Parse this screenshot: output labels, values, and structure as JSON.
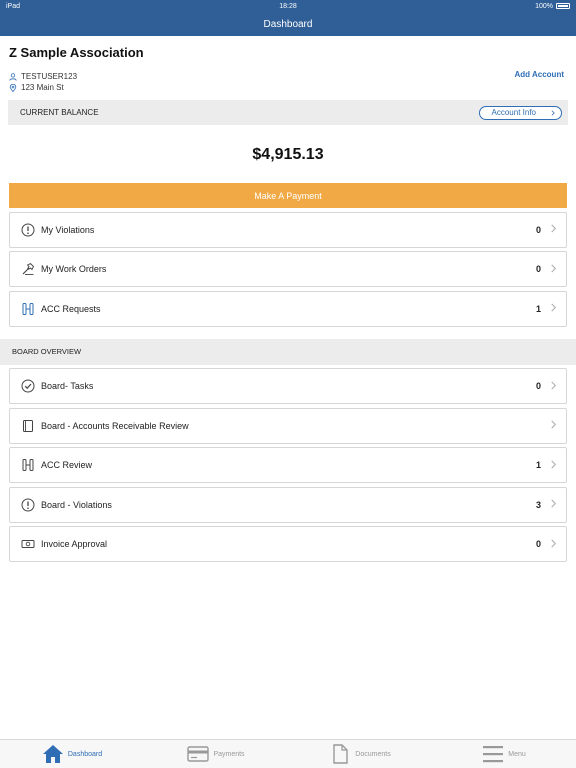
{
  "status_bar": {
    "device": "iPad",
    "time": "18:28",
    "battery": "100%"
  },
  "nav": {
    "title": "Dashboard"
  },
  "association": {
    "name": "Z Sample Association",
    "user": "TESTUSER123",
    "address": "123 Main St",
    "add_account": "Add Account"
  },
  "balance": {
    "label": "CURRENT BALANCE",
    "account_info": "Account Info",
    "amount": "$4,915.13",
    "pay_button": "Make A Payment"
  },
  "items": [
    {
      "label": "My Violations",
      "count": "0",
      "icon": "exclamation-circle-icon"
    },
    {
      "label": "My Work Orders",
      "count": "0",
      "icon": "hammer-icon"
    },
    {
      "label": "ACC Requests",
      "count": "1",
      "icon": "acc-icon"
    }
  ],
  "board": {
    "header": "BOARD OVERVIEW",
    "items": [
      {
        "label": "Board- Tasks",
        "count": "0",
        "icon": "check-circle-icon"
      },
      {
        "label": "Board - Accounts Receivable Review",
        "count": "",
        "icon": "book-icon"
      },
      {
        "label": "ACC Review",
        "count": "1",
        "icon": "acc-icon"
      },
      {
        "label": "Board - Violations",
        "count": "3",
        "icon": "exclamation-circle-icon"
      },
      {
        "label": "Invoice Approval",
        "count": "0",
        "icon": "banknote-icon"
      }
    ]
  },
  "tabs": [
    {
      "label": "Dashboard",
      "icon": "home-icon",
      "active": true
    },
    {
      "label": "Payments",
      "icon": "credit-card-icon",
      "active": false
    },
    {
      "label": "Documents",
      "icon": "document-icon",
      "active": false
    },
    {
      "label": "Menu",
      "icon": "menu-icon",
      "active": false
    }
  ],
  "colors": {
    "primary": "#2f5f96",
    "accent": "#f0a944",
    "link": "#2f6db5"
  }
}
